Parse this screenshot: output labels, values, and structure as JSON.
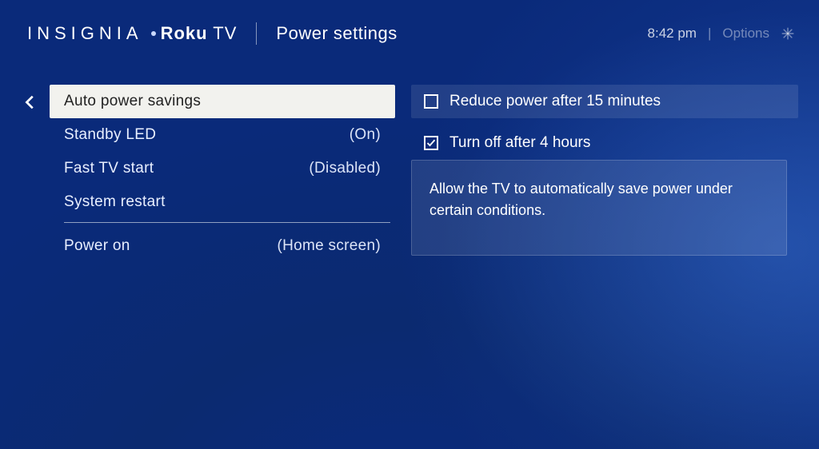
{
  "header": {
    "brand_left": "INSIGNIA",
    "brand_roku": "Roku",
    "brand_tv": "TV",
    "page_title": "Power settings",
    "clock": "8:42 pm",
    "options_label": "Options"
  },
  "menu": {
    "items": [
      {
        "label": "Auto power savings",
        "value": "",
        "selected": true
      },
      {
        "label": "Standby LED",
        "value": "(On)",
        "selected": false
      },
      {
        "label": "Fast TV start",
        "value": "(Disabled)",
        "selected": false
      },
      {
        "label": "System restart",
        "value": "",
        "selected": false
      }
    ],
    "after_divider": [
      {
        "label": "Power on",
        "value": "(Home screen)",
        "selected": false
      }
    ]
  },
  "options": [
    {
      "label": "Reduce power after 15 minutes",
      "checked": false,
      "selected": true
    },
    {
      "label": "Turn off after 4 hours",
      "checked": true,
      "selected": false
    }
  ],
  "description": "Allow the TV to automatically save power under certain conditions."
}
